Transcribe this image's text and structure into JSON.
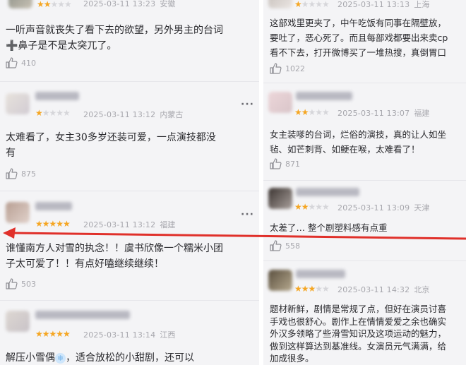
{
  "left_column": {
    "comments": [
      {
        "date": "2025-03-11 13:23",
        "location": "安徽",
        "stars": 2,
        "lines": [
          "一听声音就丧失了看下去的欲望，另外男主的台词",
          "➕鼻子是不是太突兀了。"
        ],
        "likes": "410"
      },
      {
        "date": "2025-03-11 13:12",
        "location": "内蒙古",
        "stars": 1,
        "lines": [
          "太难看了，女主30多岁还装可爱，一点演技都没",
          "有"
        ],
        "likes": "875",
        "more": "···"
      },
      {
        "date": "2025-03-11 13:12",
        "location": "福建",
        "stars": 5,
        "lines": [
          "谁懂南方人对雪的执念！！虞书欣像一个糯米小团",
          "子太可爱了！！有点好嗑继续继续！"
        ],
        "likes": "503",
        "more": "···"
      },
      {
        "date": "2025-03-11 13:14",
        "location": "江西",
        "stars": 5,
        "line_start": "解压小雪偶",
        "line_end": "，适合放松的小甜剧，还可以"
      }
    ]
  },
  "right_column": {
    "comments": [
      {
        "date": "2025-03-11 13:13",
        "location": "上海",
        "stars": 1,
        "lines": [
          "这部戏里更夹了，中午吃饭有同事在隔壁放，",
          "要吐了，恶心死了。而且每部戏都要出来卖cp",
          "看不下去，打开微博买了一堆热搜，真倒胃口"
        ],
        "likes": "1022"
      },
      {
        "date": "2025-03-11 13:07",
        "location": "福建",
        "stars": 2,
        "lines": [
          "女主装嗲的台词，烂俗的演技，真的让人如坐",
          "毡、如芒刺背、如鲠在喉，太难看了！"
        ],
        "likes": "871"
      },
      {
        "date": "2025-03-11 13:09",
        "location": "天津",
        "stars": 2,
        "lines": [
          "太差了… 整个剧塑料感有点重"
        ],
        "likes": "558"
      },
      {
        "date": "2025-03-11 14:32",
        "location": "北京",
        "stars": 3,
        "lines": [
          "题材新鲜，剧情是常规了点，但好在演员讨喜",
          "手戏也很舒心。剧作上在情情爱爱之余也确实",
          "外汉多领略了些滑雪知识及这项运动的魅力，",
          "做到这样算达到基准线。女演员元气满满，给",
          "加成很多。"
        ]
      }
    ]
  },
  "colors": {
    "accent_star": "#f5a623",
    "annotation_arrow": "#e0302a",
    "muted_text": "#a7a7ad"
  },
  "icons": {
    "like": "thumbs-up-icon",
    "more": "more-dots-icon",
    "snowflake": "snowflake-emoji-icon",
    "plus": "heavy-plus-emoji"
  }
}
